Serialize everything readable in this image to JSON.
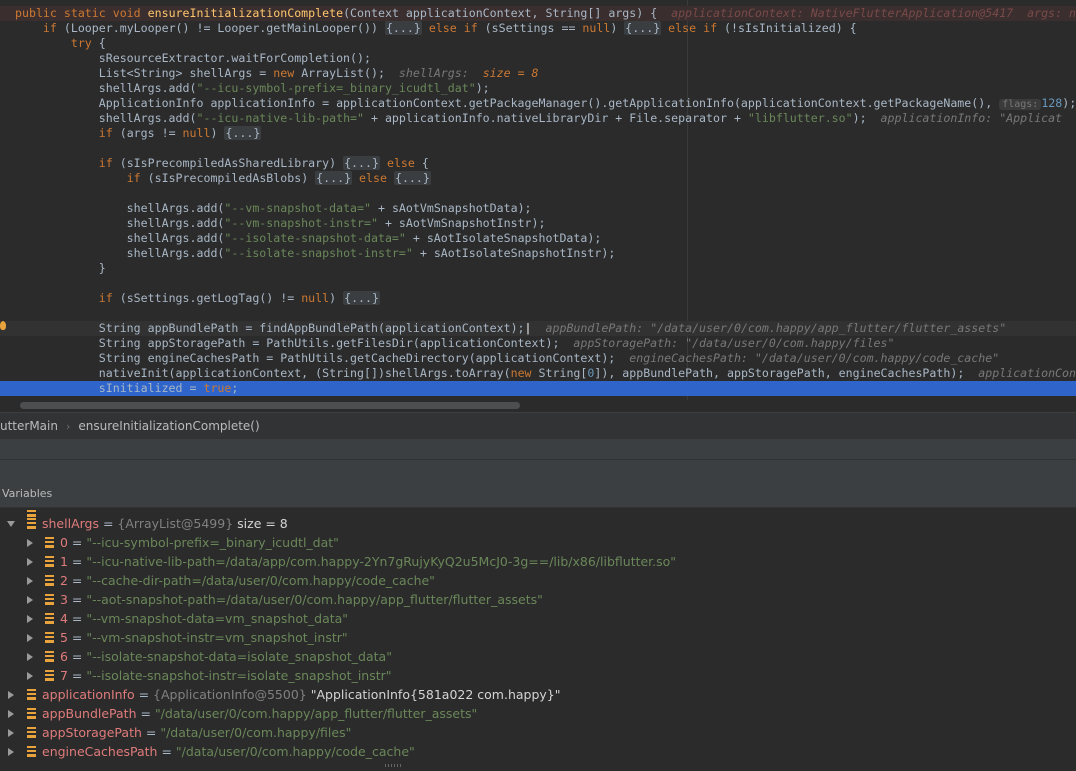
{
  "editor": {
    "l1": {
      "kw1": "public static void ",
      "fn": "ensureInitializationComplete",
      "p1": "(Context applicationContext, String[] args) {  ",
      "hint": "applicationContext: NativeFlutterApplication@5417  args: n"
    },
    "l2": {
      "a": "    ",
      "kw1": "if",
      "b": " (Looper.myLooper() != Looper.getMainLooper()) ",
      "f1": "{...}",
      "kw2": " else if",
      "c": " (sSettings == ",
      "kw3": "null",
      "d": ") ",
      "f2": "{...}",
      "kw4": " else if",
      "e": " (!sIsInitialized) {"
    },
    "l3": {
      "a": "        ",
      "kw": "try",
      "b": " {"
    },
    "l4": {
      "a": "            sResourceExtractor.waitForCompletion();"
    },
    "l5": {
      "a": "            List<String> shellArgs = ",
      "kw": "new",
      "b": " ArrayList();  ",
      "hint": "shellArgs:",
      "hintv": "  size = 8"
    },
    "l6": {
      "a": "            shellArgs.add(",
      "s": "\"--icu-symbol-prefix=_binary_icudtl_dat\"",
      "b": ");"
    },
    "l7": {
      "a": "            ApplicationInfo applicationInfo = applicationContext.getPackageManager().getApplicationInfo(applicationContext.getPackageName(), ",
      "box": "flags:",
      "num": "128",
      "b": ");"
    },
    "l8": {
      "a": "            shellArgs.add(",
      "s1": "\"--icu-native-lib-path=\"",
      "b": " + applicationInfo.nativeLibraryDir + File.separator + ",
      "s2": "\"libflutter.so\"",
      "c": ");  ",
      "hint": "applicationInfo: \"Applicat"
    },
    "l9": {
      "a": "            ",
      "kw": "if",
      "b": " (args != ",
      "kw2": "null",
      "c": ") ",
      "f": "{...}"
    },
    "l11": {
      "a": "            ",
      "kw": "if",
      "b": " (sIsPrecompiledAsSharedLibrary) ",
      "f": "{...}",
      "kw2": " else",
      "c": " {"
    },
    "l12": {
      "a": "                ",
      "kw": "if",
      "b": " (sIsPrecompiledAsBlobs) ",
      "f1": "{...}",
      "kw2": " else ",
      "f2": "{...}"
    },
    "l14": {
      "a": "                shellArgs.add(",
      "s": "\"--vm-snapshot-data=\"",
      "b": " + sAotVmSnapshotData);"
    },
    "l15": {
      "a": "                shellArgs.add(",
      "s": "\"--vm-snapshot-instr=\"",
      "b": " + sAotVmSnapshotInstr);"
    },
    "l16": {
      "a": "                shellArgs.add(",
      "s": "\"--isolate-snapshot-data=\"",
      "b": " + sAotIsolateSnapshotData);"
    },
    "l17": {
      "a": "                shellArgs.add(",
      "s": "\"--isolate-snapshot-instr=\"",
      "b": " + sAotIsolateSnapshotInstr);"
    },
    "l18": {
      "a": "            }"
    },
    "l20": {
      "a": "            ",
      "kw": "if",
      "b": " (sSettings.getLogTag() != ",
      "kw2": "null",
      "c": ") ",
      "f": "{...}"
    },
    "l22": {
      "a": "            String appBundlePath = findAppBundlePath(applicationContext);",
      "caret": "|",
      "b": "  ",
      "hint": "appBundlePath: \"/data/user/0/com.happy/app_flutter/flutter_assets\""
    },
    "l23": {
      "a": "            String appStoragePath = PathUtils.getFilesDir(applicationContext);  ",
      "hint": "appStoragePath: \"/data/user/0/com.happy/files\""
    },
    "l24": {
      "a": "            String engineCachesPath = PathUtils.getCacheDirectory(applicationContext);  ",
      "hint": "engineCachesPath: \"/data/user/0/com.happy/code_cache\""
    },
    "l25": {
      "a": "            nativeInit(applicationContext, (String[])shellArgs.toArray(",
      "kw": "new",
      "b": " String[",
      "num": "0",
      "c": "]), appBundlePath, appStoragePath, engineCachesPath);  ",
      "hint": "applicationCon"
    },
    "l26": {
      "a": "            sInitialized = ",
      "kw": "true",
      "b": ";"
    }
  },
  "breadcrumb": {
    "item1": "utterMain",
    "item2": "ensureInitializationComplete()"
  },
  "variables": {
    "title": "Variables",
    "rows": [
      {
        "name": "shellArgs",
        "eq": " = ",
        "ref": "{ArrayList@5499}",
        "extra": "  size = 8"
      },
      {
        "name": "0",
        "eq": " = ",
        "val": "\"--icu-symbol-prefix=_binary_icudtl_dat\""
      },
      {
        "name": "1",
        "eq": " = ",
        "val": "\"--icu-native-lib-path=/data/app/com.happy-2Yn7gRujyKyQ2u5McJ0-3g==/lib/x86/libflutter.so\""
      },
      {
        "name": "2",
        "eq": " = ",
        "val": "\"--cache-dir-path=/data/user/0/com.happy/code_cache\""
      },
      {
        "name": "3",
        "eq": " = ",
        "val": "\"--aot-snapshot-path=/data/user/0/com.happy/app_flutter/flutter_assets\""
      },
      {
        "name": "4",
        "eq": " = ",
        "val": "\"--vm-snapshot-data=vm_snapshot_data\""
      },
      {
        "name": "5",
        "eq": " = ",
        "val": "\"--vm-snapshot-instr=vm_snapshot_instr\""
      },
      {
        "name": "6",
        "eq": " = ",
        "val": "\"--isolate-snapshot-data=isolate_snapshot_data\""
      },
      {
        "name": "7",
        "eq": " = ",
        "val": "\"--isolate-snapshot-instr=isolate_snapshot_instr\""
      },
      {
        "name": "applicationInfo",
        "eq": " = ",
        "ref": "{ApplicationInfo@5500}",
        "extra": " \"ApplicationInfo{581a022 com.happy}\""
      },
      {
        "name": "appBundlePath",
        "eq": " = ",
        "val": "\"/data/user/0/com.happy/app_flutter/flutter_assets\""
      },
      {
        "name": "appStoragePath",
        "eq": " = ",
        "val": "\"/data/user/0/com.happy/files\""
      },
      {
        "name": "engineCachesPath",
        "eq": " = ",
        "val": "\"/data/user/0/com.happy/code_cache\""
      }
    ]
  },
  "colors": {
    "selection": "#2f65ca",
    "background": "#2b2b2b",
    "keyword": "#cc7832",
    "string": "#6a8759",
    "fieldName": "#e07b7b"
  }
}
